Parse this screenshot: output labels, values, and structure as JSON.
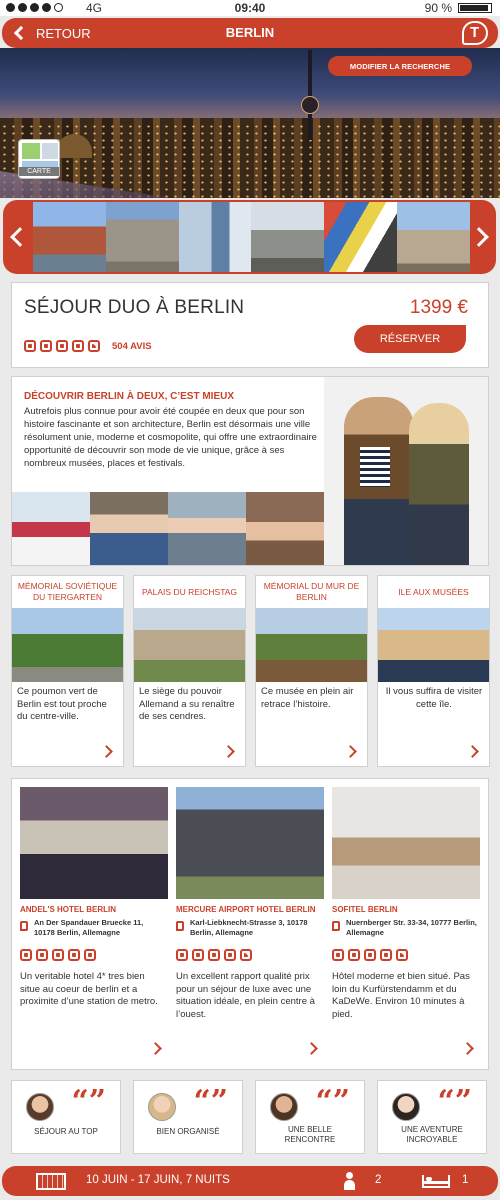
{
  "status_bar": {
    "network": "4G",
    "time": "09:40",
    "battery": "90 %"
  },
  "header": {
    "back_label": "RETOUR",
    "title": "BERLIN"
  },
  "hero": {
    "modify_label": "MODIFIER LA RECHERCHE",
    "map_label": "CARTE"
  },
  "stay": {
    "title": "SÉJOUR DUO À BERLIN",
    "price": "1399 €",
    "rating": 4.5,
    "reviews": "504 AVIS",
    "reserve_label": "RÉSERVER"
  },
  "discover": {
    "heading": "DÉCOUVRIR BERLIN À DEUX, C’EST MIEUX",
    "text": "Autrefois plus connue pour avoir été coupée en deux que pour son histoire fascinante et son architecture, Berlin est désormais une ville résolument unie, moderne et cosmopolite, qui offre une extraordinaire opportunité de découvrir son mode de vie unique, grâce à ses nombreux musées, places et festivals."
  },
  "places": [
    {
      "title": "MÉMORIAL SOVIÉTIQUE DU TIERGARTEN",
      "desc": "Ce poumon vert de Berlin est tout proche du centre-ville."
    },
    {
      "title": "PALAIS DU REICHSTAG",
      "desc": "Le siège du pouvoir Allemand a su renaître de ses cendres."
    },
    {
      "title": "MÉMORIAL DU MUR DE BERLIN",
      "desc": "Ce musée en plein air retrace l’histoire."
    },
    {
      "title": "ILE AUX MUSÉES",
      "desc": "Il vous suffira de visiter cette île."
    }
  ],
  "hotels": [
    {
      "name": "ANDEL'S HOTEL BERLIN",
      "address": "An Der Spandauer Bruecke 11, 10178 Berlin, Allemagne",
      "rating": 5,
      "desc": "Un veritable hotel 4* tres bien situe au coeur de berlin et a proximite d’une station de metro."
    },
    {
      "name": "MERCURE AIRPORT HOTEL BERLIN",
      "address": "Karl-Liebknecht-Strasse 3, 10178 Berlin, Allemagne",
      "rating": 4.5,
      "desc": "Un excellent rapport qualité prix pour un séjour de luxe avec une situation idéale, en plein centre à l’ouest."
    },
    {
      "name": "SOFITEL BERLIN",
      "address": "Nuernberger Str. 33-34, 10777 Berlin, Allemagne",
      "rating": 4.5,
      "desc": "Hôtel moderne et bien situé. Pas loin du Kurfürstendamm et du KaDeWe. Environ 10 minutes à pied."
    }
  ],
  "reviews": [
    {
      "text": "SÉJOUR AU TOP"
    },
    {
      "text": "BIEN ORGANISÉ"
    },
    {
      "text": "UNE BELLE RENCONTRE"
    },
    {
      "text": "UNE AVENTURE INCROYABLE"
    }
  ],
  "quote_mark": "“”",
  "bottom_bar": {
    "dates": "10 JUIN - 17 JUIN, 7 NUITS",
    "travelers": "2",
    "rooms": "1"
  },
  "colors": {
    "accent": "#c9412a",
    "background": "#eaeaea"
  },
  "icons": [
    "back-chevron-icon",
    "brand-logo-icon",
    "map-icon",
    "carousel-left-icon",
    "carousel-right-icon",
    "rating-dot-icon",
    "location-pin-icon",
    "arrow-right-icon",
    "quote-icon",
    "calendar-icon",
    "people-icon",
    "bed-icon"
  ]
}
